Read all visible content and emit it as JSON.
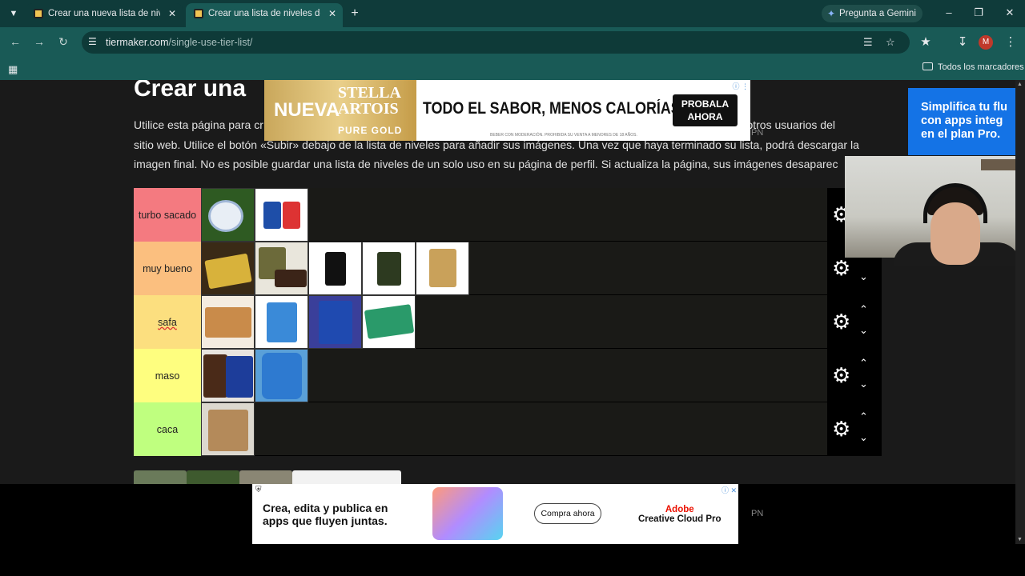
{
  "browser": {
    "tabs": [
      {
        "label": "Crear una nueva lista de niveles",
        "active": false
      },
      {
        "label": "Crear una lista de niveles de un",
        "active": true
      }
    ],
    "gemini_label": "Pregunta a Gemini",
    "url_host": "tiermaker.com",
    "url_path": "/single-use-tier-list/",
    "profile_initial": "M",
    "bookmarks_all": "Todos los marcadores"
  },
  "page": {
    "heading": "Crear una",
    "intro": "Utilice esta página para cr... para otros usuarios del sitio web. Utilice el botón «Subir» debajo de la lista de niveles para añadir sus imágenes. Una vez que haya terminado su lista, podrá descargar la imagen final. No es posible guardar una lista de niveles de un solo uso en su página de perfil. Si actualiza la página, sus imágenes desaparec",
    "intro_line1": "Utilice esta página para cr",
    "intro_line1_end": "e para otros usuarios del",
    "intro_line2": "sitio web. Utilice el botón «Subir» debajo de la lista de niveles para añadir sus imágenes. Una vez que haya terminado su lista, podrá descargar la",
    "intro_line3": "imagen final. No es posible guardar una lista de niveles de un solo uso en su página de perfil. Si actualiza la página, sus imágenes desaparec"
  },
  "tiers": [
    {
      "label": "turbo sacado",
      "color": "#f47a80",
      "items": 2
    },
    {
      "label": "muy bueno",
      "color": "#fbbf7f",
      "items": 5
    },
    {
      "label": "safa",
      "color": "#fcdf7f",
      "items": 4
    },
    {
      "label": "maso",
      "color": "#fefe7f",
      "items": 2
    },
    {
      "label": "caca",
      "color": "#bfff7f",
      "items": 1
    }
  ],
  "ad_top": {
    "brand_line1": "NUEVA",
    "brand_line2": "STELLA",
    "brand_line3": "ARTOIS",
    "brand_line4": "PURE GOLD",
    "slogan": "TODO EL SABOR, MENOS CALORÍAS",
    "cta_line1": "PROBALA",
    "cta_line2": "AHORA",
    "fine": "BEBER CON MODERACIÓN. PROHIBIDA SU VENTA A MENORES DE 18 AÑOS."
  },
  "ad_bottom": {
    "line1": "Crea, edita y publica en",
    "line2": "apps que fluyen juntas.",
    "cta": "Compra ahora",
    "brand_line1": "Adobe",
    "brand_line2": "Creative Cloud Pro"
  },
  "side_ad": {
    "line1": "Simplifica tu flu",
    "line2": "con apps integ",
    "line3": "en el plan Pro."
  },
  "watermark": "PN",
  "icons": {
    "gear": "gear-icon",
    "up": "chevron-up-icon",
    "down": "chevron-down-icon"
  }
}
